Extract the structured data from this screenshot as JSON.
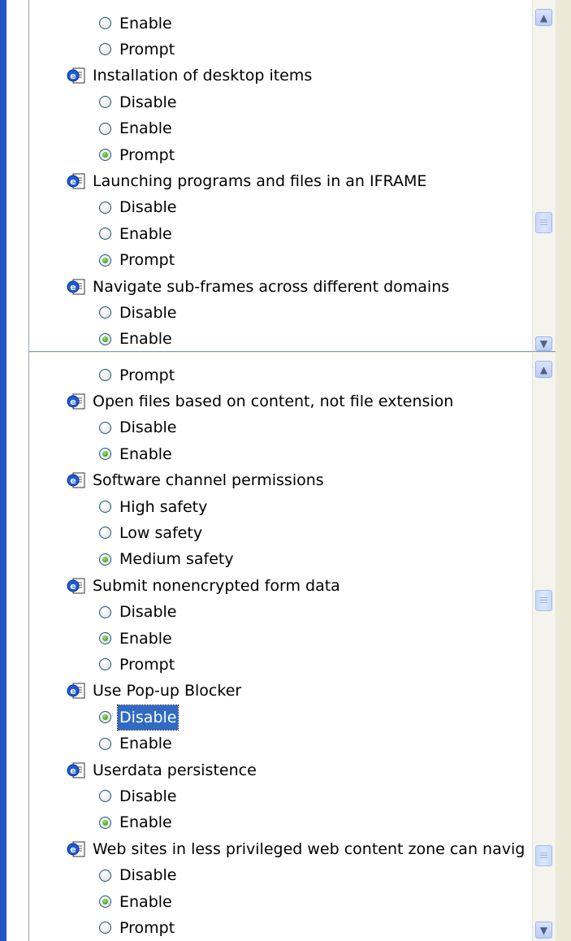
{
  "top_panel": {
    "items": [
      {
        "kind": "option",
        "label": "Enable",
        "checked": false
      },
      {
        "kind": "option",
        "label": "Prompt",
        "checked": false
      },
      {
        "kind": "setting",
        "label": "Installation of desktop items",
        "icon": "ie-settings-icon"
      },
      {
        "kind": "option",
        "label": "Disable",
        "checked": false
      },
      {
        "kind": "option",
        "label": "Enable",
        "checked": false
      },
      {
        "kind": "option",
        "label": "Prompt",
        "checked": true
      },
      {
        "kind": "setting",
        "label": "Launching programs and files in an IFRAME",
        "icon": "ie-settings-icon"
      },
      {
        "kind": "option",
        "label": "Disable",
        "checked": false
      },
      {
        "kind": "option",
        "label": "Enable",
        "checked": false
      },
      {
        "kind": "option",
        "label": "Prompt",
        "checked": true
      },
      {
        "kind": "setting",
        "label": "Navigate sub-frames across different domains",
        "icon": "ie-settings-icon"
      },
      {
        "kind": "option",
        "label": "Disable",
        "checked": false
      },
      {
        "kind": "option",
        "label": "Enable",
        "checked": true
      }
    ]
  },
  "bottom_panel": {
    "items": [
      {
        "kind": "option",
        "label": "Prompt",
        "checked": false
      },
      {
        "kind": "setting",
        "label": "Open files based on content, not file extension",
        "icon": "ie-settings-icon"
      },
      {
        "kind": "option",
        "label": "Disable",
        "checked": false
      },
      {
        "kind": "option",
        "label": "Enable",
        "checked": true
      },
      {
        "kind": "setting",
        "label": "Software channel permissions",
        "icon": "ie-settings-icon"
      },
      {
        "kind": "option",
        "label": "High safety",
        "checked": false
      },
      {
        "kind": "option",
        "label": "Low safety",
        "checked": false
      },
      {
        "kind": "option",
        "label": "Medium safety",
        "checked": true
      },
      {
        "kind": "setting",
        "label": "Submit nonencrypted form data",
        "icon": "ie-settings-icon"
      },
      {
        "kind": "option",
        "label": "Disable",
        "checked": false
      },
      {
        "kind": "option",
        "label": "Enable",
        "checked": true
      },
      {
        "kind": "option",
        "label": "Prompt",
        "checked": false
      },
      {
        "kind": "setting",
        "label": "Use Pop-up Blocker",
        "icon": "ie-settings-icon"
      },
      {
        "kind": "option",
        "label": "Disable",
        "checked": true,
        "selected": true
      },
      {
        "kind": "option",
        "label": "Enable",
        "checked": false
      },
      {
        "kind": "setting",
        "label": "Userdata persistence",
        "icon": "ie-settings-icon"
      },
      {
        "kind": "option",
        "label": "Disable",
        "checked": false
      },
      {
        "kind": "option",
        "label": "Enable",
        "checked": true
      },
      {
        "kind": "setting",
        "label": "Web sites in less privileged web content zone can navig",
        "icon": "ie-settings-icon"
      },
      {
        "kind": "option",
        "label": "Disable",
        "checked": false
      },
      {
        "kind": "option",
        "label": "Enable",
        "checked": true
      },
      {
        "kind": "option",
        "label": "Prompt",
        "checked": false
      }
    ]
  },
  "colors": {
    "selection": "#316ac5",
    "accent_strip": "#2755c9",
    "radio_dot": "#2f9a1f"
  }
}
